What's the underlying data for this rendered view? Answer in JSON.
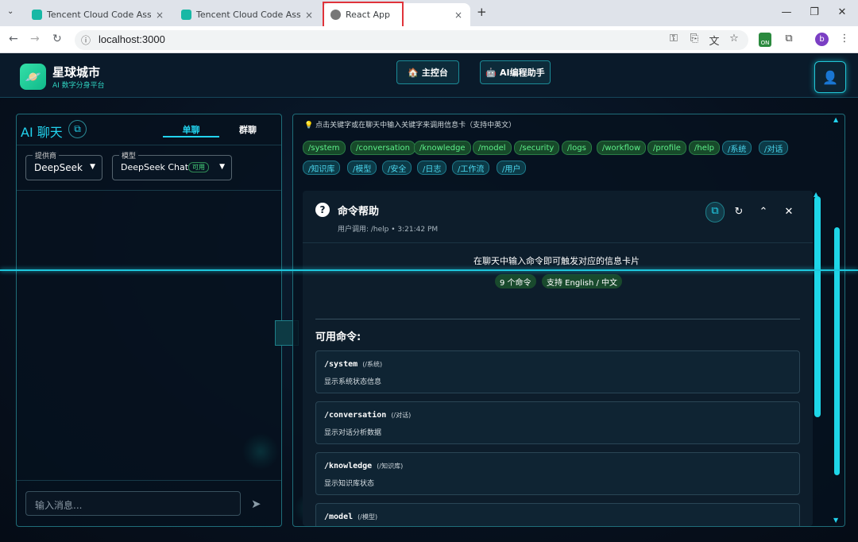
{
  "browser": {
    "tabs": [
      {
        "title": "Tencent Cloud Code Assistan",
        "close": "×"
      },
      {
        "title": "Tencent Cloud Code Assistan",
        "close": "×"
      },
      {
        "title": "React App",
        "close": "×"
      }
    ],
    "new_tab": "+",
    "url": "localhost:3000",
    "profile_initial": "b",
    "extension_badge": "ON"
  },
  "header": {
    "brand": "星球城市",
    "subtitle": "AI 数字分身平台",
    "nav": [
      {
        "icon": "🏠",
        "label": "主控台"
      },
      {
        "icon": "🤖",
        "label": "AI编程助手"
      }
    ]
  },
  "chat": {
    "title": "AI 聊天",
    "tabs": [
      "单聊",
      "群聊"
    ],
    "provider_label": "提供商",
    "provider_value": "DeepSeek",
    "model_label": "模型",
    "model_value": "DeepSeek Chat",
    "model_badge": "可用",
    "input_placeholder": "输入消息..."
  },
  "commands_panel": {
    "hint": "点击关键字或在聊天中输入关键字来调用信息卡（支持中英文）",
    "keywords": [
      {
        "text": "/system",
        "lang": "en"
      },
      {
        "text": "/conversation",
        "lang": "en"
      },
      {
        "text": "/knowledge",
        "lang": "en"
      },
      {
        "text": "/model",
        "lang": "en"
      },
      {
        "text": "/security",
        "lang": "en"
      },
      {
        "text": "/logs",
        "lang": "en"
      },
      {
        "text": "/workflow",
        "lang": "en"
      },
      {
        "text": "/profile",
        "lang": "en"
      },
      {
        "text": "/help",
        "lang": "en"
      },
      {
        "text": "/系统",
        "lang": "zh"
      },
      {
        "text": "/对话",
        "lang": "zh"
      },
      {
        "text": "/知识库",
        "lang": "zh"
      },
      {
        "text": "/模型",
        "lang": "zh"
      },
      {
        "text": "/安全",
        "lang": "zh"
      },
      {
        "text": "/日志",
        "lang": "zh"
      },
      {
        "text": "/工作流",
        "lang": "zh"
      },
      {
        "text": "/用户",
        "lang": "zh"
      }
    ],
    "card": {
      "title": "命令帮助",
      "subtitle": "用户调用: /help • 3:21:42 PM",
      "lead": "在聊天中输入命令即可触发对应的信息卡片",
      "pills": [
        "9 个命令",
        "支持 English / 中文"
      ],
      "section_title": "可用命令:",
      "commands": [
        {
          "name": "/system",
          "alias": "(/系统)",
          "desc": "显示系统状态信息"
        },
        {
          "name": "/conversation",
          "alias": "(/对话)",
          "desc": "显示对话分析数据"
        },
        {
          "name": "/knowledge",
          "alias": "(/知识库)",
          "desc": "显示知识库状态"
        },
        {
          "name": "/model",
          "alias": "(/模型)",
          "desc": ""
        }
      ]
    }
  },
  "colors": {
    "accent": "#22d3ee",
    "green": "#4ade80",
    "bg": "#07111f"
  }
}
